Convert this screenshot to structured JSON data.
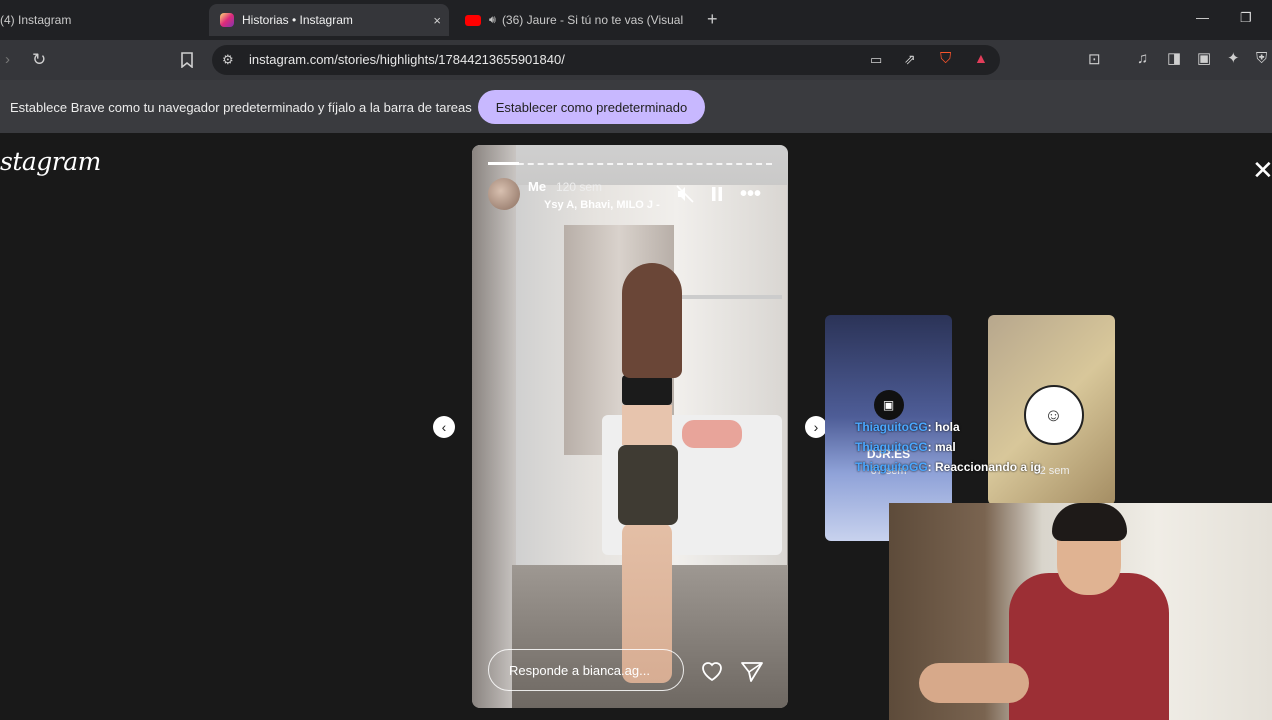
{
  "browser": {
    "tabs": [
      {
        "label": "(4) Instagram",
        "active": false
      },
      {
        "label": "Historias • Instagram",
        "active": true
      },
      {
        "label": "(36) Jaure - Si tú no te vas (Visual",
        "active": false
      }
    ],
    "tab_close_glyph": "×",
    "new_tab_glyph": "+",
    "address": "instagram.com/stories/highlights/17844213655901840/"
  },
  "infobar": {
    "message": "Establece Brave como tu navegador predeterminado y fíjalo a la barra de tareas",
    "button_label": "Establecer como predeterminado"
  },
  "instagram": {
    "logo_text": "stagram",
    "close_glyph": "✕",
    "story": {
      "user": "Me",
      "time": "120 sem",
      "song": "Ysy A, Bhavi, MILO J -",
      "progress": 0.11,
      "reply_placeholder": "Responde a bianca.ag..."
    },
    "previews": [
      {
        "name": "DJR.ES",
        "time": "67 sem"
      },
      {
        "name": "",
        "time": "62 sem"
      }
    ]
  },
  "stream_chat": [
    {
      "user": "ThiaguitoGG",
      "sep": ":",
      "message": "hola"
    },
    {
      "user": "ThiaguitoGG",
      "sep": ":",
      "message": "mal"
    },
    {
      "user": "ThiaguitoGG",
      "sep": ":",
      "message": "Reaccionando a ig"
    }
  ],
  "colors": {
    "accent_button": "#c8b8ff",
    "chat_user": "#4aa8ff",
    "youtube_red": "#ff0000",
    "instagram_grad": "#dd2a7b"
  },
  "icons": [
    "instagram-icon",
    "youtube-icon",
    "speaker-icon",
    "reload-icon",
    "bookmark-icon",
    "site-info-icon",
    "mute-icon",
    "pause-icon",
    "more-icon",
    "heart-icon",
    "send-icon",
    "chevron-left-icon"
  ]
}
